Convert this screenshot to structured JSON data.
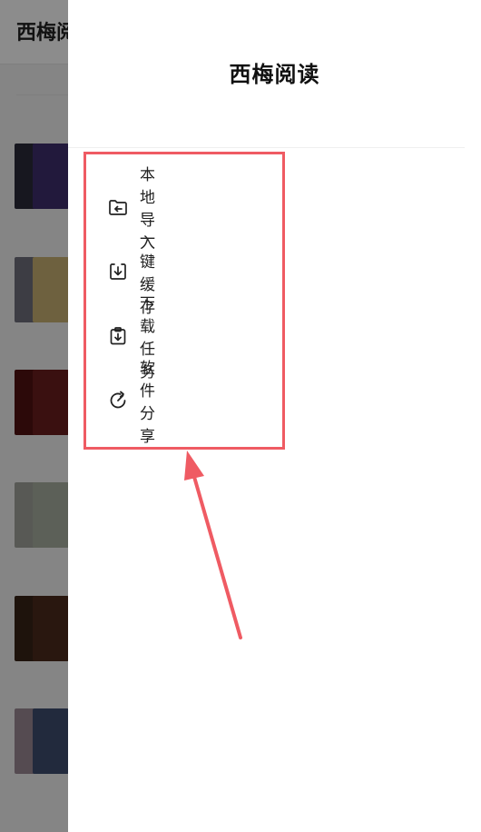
{
  "background": {
    "app_title_partial": "西梅阅",
    "book_covers": [
      {
        "back": "#2b2b3a",
        "front": "#3e2f6d"
      },
      {
        "back": "#6f6f7c",
        "front": "#c8b174"
      },
      {
        "back": "#511111",
        "front": "#6a1e1e"
      },
      {
        "back": "#a1a39c",
        "front": "#a8b0a0"
      },
      {
        "back": "#372317",
        "front": "#4c2b1d"
      },
      {
        "back": "#9b8994",
        "front": "#3f4e70"
      }
    ]
  },
  "drawer": {
    "title": "西梅阅读",
    "menu": [
      {
        "label": "本地导入",
        "icon": "folder-import-icon"
      },
      {
        "label": "一键缓存",
        "icon": "download-tray-icon"
      },
      {
        "label": "下载任务",
        "icon": "clipboard-download-icon"
      },
      {
        "label": "软件分享",
        "icon": "share-refresh-icon"
      }
    ]
  },
  "annotation": {
    "highlight_color": "#ef5b63"
  }
}
